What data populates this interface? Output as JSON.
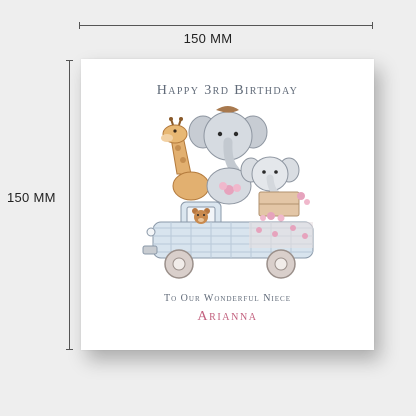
{
  "dimensions": {
    "width_label": "150 MM",
    "height_label": "150 MM"
  },
  "card": {
    "title": "Happy 3rd Birthday",
    "subtitle": "To Our Wonderful Niece",
    "name": "Arianna",
    "name_color": "#c25f7d",
    "text_color": "#606a78"
  },
  "illustration": {
    "elements": [
      "giraffe",
      "elephant",
      "baby-elephant",
      "teddy-bear",
      "truck",
      "flowers"
    ]
  }
}
